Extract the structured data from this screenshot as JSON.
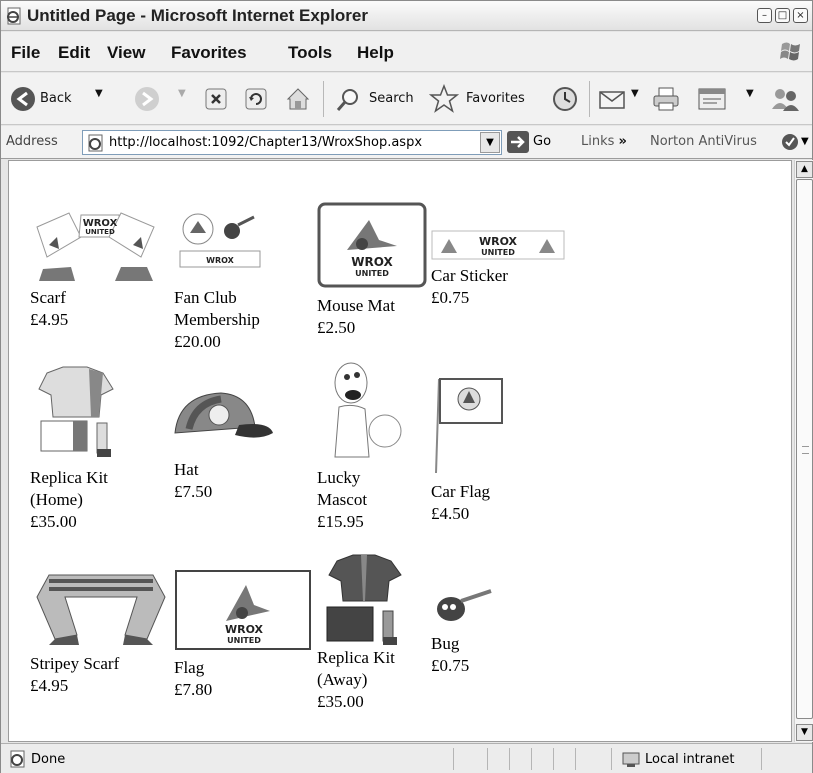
{
  "window": {
    "title": "Untitled Page - Microsoft Internet Explorer",
    "controls": [
      "–",
      "□",
      "×"
    ]
  },
  "menu": [
    "File",
    "Edit",
    "View",
    "Favorites",
    "Tools",
    "Help"
  ],
  "toolbar": {
    "back_label": "Back",
    "search_label": "Search",
    "favorites_label": "Favorites"
  },
  "address": {
    "label": "Address",
    "url": "http://localhost:1092/Chapter13/WroxShop.aspx",
    "go_label": "Go",
    "links_label": "Links",
    "links_chevron": "»",
    "norton_label": "Norton AntiVirus"
  },
  "products": [
    {
      "name": "Scarf",
      "price": "£4.95",
      "icon": "scarf-image"
    },
    {
      "name": "Fan Club\nMembership",
      "price": "£20.00",
      "icon": "fan-club-image"
    },
    {
      "name": "Mouse Mat",
      "price": "£2.50",
      "icon": "mouse-mat-image"
    },
    {
      "name": "Car Sticker",
      "price": "£0.75",
      "icon": "car-sticker-image"
    },
    {
      "name": "Replica Kit\n(Home)",
      "price": "£35.00",
      "icon": "replica-kit-home-image"
    },
    {
      "name": "Hat",
      "price": "£7.50",
      "icon": "hat-image"
    },
    {
      "name": "Lucky\nMascot",
      "price": "£15.95",
      "icon": "lucky-mascot-image"
    },
    {
      "name": "Car Flag",
      "price": "£4.50",
      "icon": "car-flag-image"
    },
    {
      "name": "Stripey Scarf",
      "price": "£4.95",
      "icon": "stripey-scarf-image"
    },
    {
      "name": "Flag",
      "price": "£7.80",
      "icon": "flag-image"
    },
    {
      "name": "Replica Kit\n(Away)",
      "price": "£35.00",
      "icon": "replica-kit-away-image"
    },
    {
      "name": "Bug",
      "price": "£0.75",
      "icon": "bug-image"
    }
  ],
  "logo_text": {
    "line1": "WROX",
    "line2": "UNITED"
  },
  "status": {
    "text": "Done",
    "zone": "Local intranet"
  }
}
